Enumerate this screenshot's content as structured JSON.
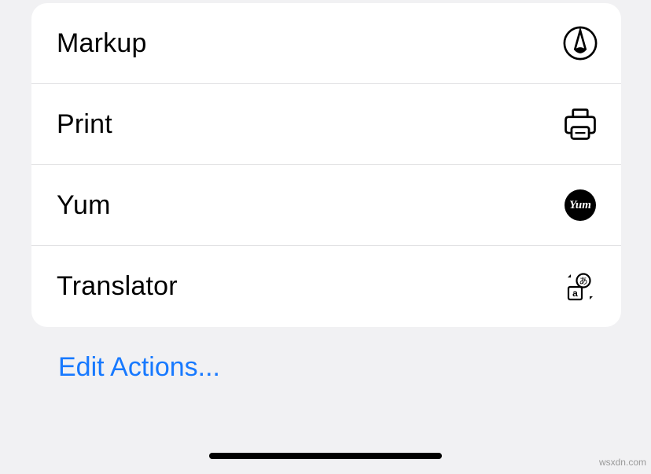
{
  "actions": {
    "items": [
      {
        "label": "Markup",
        "icon": "markup-icon"
      },
      {
        "label": "Print",
        "icon": "print-icon"
      },
      {
        "label": "Yum",
        "icon": "yum-icon"
      },
      {
        "label": "Translator",
        "icon": "translator-icon"
      }
    ],
    "edit_label": "Edit Actions...",
    "yum_icon_text": "Yum"
  },
  "watermark": "wsxdn.com"
}
